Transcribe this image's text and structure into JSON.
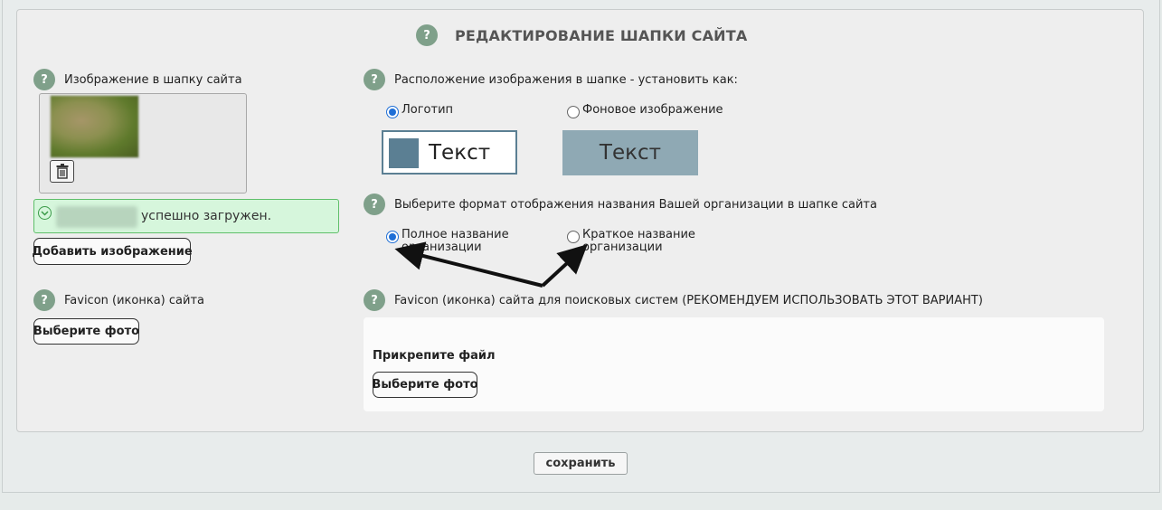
{
  "header": {
    "title": "РЕДАКТИРОВАНИЕ ШАПКИ САЙТА",
    "help": "?"
  },
  "header_image": {
    "label": "Изображение в шапку сайта",
    "help": "?",
    "success_message": "успешно загружен.",
    "add_button": "Добавить изображение"
  },
  "placement": {
    "label": "Расположение изображения в шапке - установить как:",
    "help": "?",
    "options": [
      {
        "label": "Логотип",
        "checked": true
      },
      {
        "label": "Фоновое изображение",
        "checked": false
      }
    ],
    "preview_text": "Текст"
  },
  "name_format": {
    "label": "Выберите формат отображения названия Вашей организации в шапке сайта",
    "help": "?",
    "options": [
      {
        "line1": "Полное название",
        "line2": "организации",
        "checked": true
      },
      {
        "line1": "Краткое название",
        "line2": "организации",
        "checked": false
      }
    ]
  },
  "favicon": {
    "label": "Favicon (иконка) сайта",
    "help": "?",
    "button": "Выберите фото"
  },
  "favicon_search": {
    "label": "Favicon (иконка) сайта для поисковых систем (РЕКОМЕНДУЕМ ИСПОЛЬЗОВАТЬ ЭТОТ ВАРИАНТ)",
    "help": "?",
    "attach_label": "Прикрепите файл",
    "button": "Выберите фото"
  },
  "footer": {
    "save_button": "сохранить"
  },
  "colors": {
    "help_badge": "#7fa08a",
    "preview_accent": "#5b7f93",
    "preview_bg": "#8fa9b4",
    "radio_selected": "#1f6fd6",
    "success_bg": "#d6f6dc",
    "success_border": "#5fbf6a"
  }
}
